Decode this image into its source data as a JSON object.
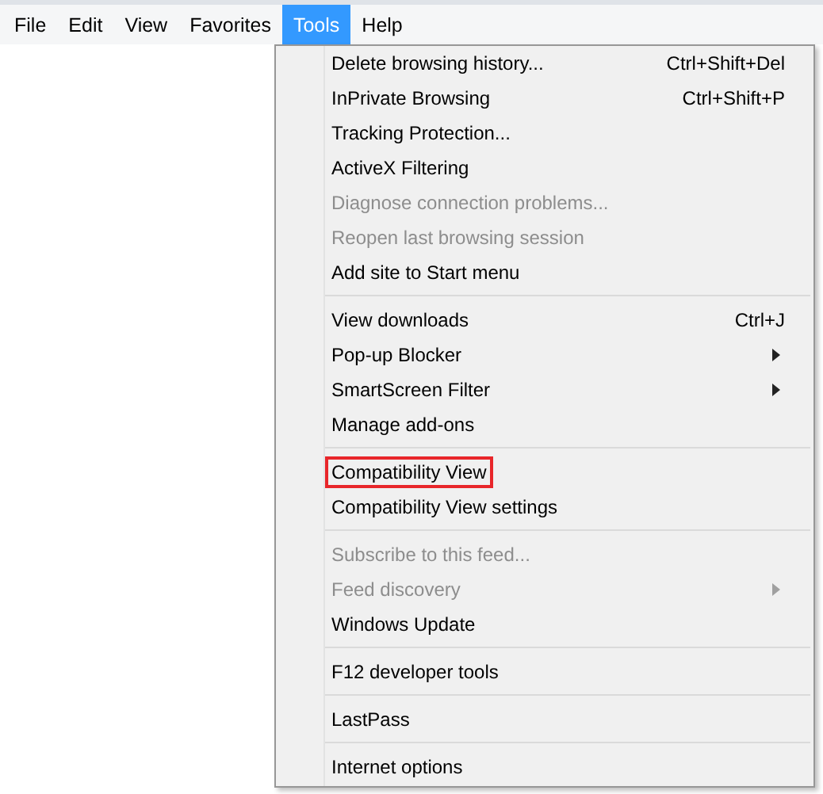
{
  "menubar": [
    {
      "label": "File",
      "selected": false
    },
    {
      "label": "Edit",
      "selected": false
    },
    {
      "label": "View",
      "selected": false
    },
    {
      "label": "Favorites",
      "selected": false
    },
    {
      "label": "Tools",
      "selected": true
    },
    {
      "label": "Help",
      "selected": false
    }
  ],
  "menu": [
    {
      "kind": "item",
      "label": "Delete browsing history...",
      "shortcut": "Ctrl+Shift+Del",
      "disabled": false,
      "submenu": false,
      "highlighted": false
    },
    {
      "kind": "item",
      "label": "InPrivate Browsing",
      "shortcut": "Ctrl+Shift+P",
      "disabled": false,
      "submenu": false,
      "highlighted": false
    },
    {
      "kind": "item",
      "label": "Tracking Protection...",
      "disabled": false,
      "submenu": false,
      "highlighted": false
    },
    {
      "kind": "item",
      "label": "ActiveX Filtering",
      "disabled": false,
      "submenu": false,
      "highlighted": false
    },
    {
      "kind": "item",
      "label": "Diagnose connection problems...",
      "disabled": true,
      "submenu": false,
      "highlighted": false
    },
    {
      "kind": "item",
      "label": "Reopen last browsing session",
      "disabled": true,
      "submenu": false,
      "highlighted": false
    },
    {
      "kind": "item",
      "label": "Add site to Start menu",
      "disabled": false,
      "submenu": false,
      "highlighted": false
    },
    {
      "kind": "separator"
    },
    {
      "kind": "item",
      "label": "View downloads",
      "shortcut": "Ctrl+J",
      "disabled": false,
      "submenu": false,
      "highlighted": false
    },
    {
      "kind": "item",
      "label": "Pop-up Blocker",
      "disabled": false,
      "submenu": true,
      "highlighted": false
    },
    {
      "kind": "item",
      "label": "SmartScreen Filter",
      "disabled": false,
      "submenu": true,
      "highlighted": false
    },
    {
      "kind": "item",
      "label": "Manage add-ons",
      "disabled": false,
      "submenu": false,
      "highlighted": false
    },
    {
      "kind": "separator"
    },
    {
      "kind": "item",
      "label": "Compatibility View",
      "disabled": false,
      "submenu": false,
      "highlighted": true
    },
    {
      "kind": "item",
      "label": "Compatibility View settings",
      "disabled": false,
      "submenu": false,
      "highlighted": false
    },
    {
      "kind": "separator"
    },
    {
      "kind": "item",
      "label": "Subscribe to this feed...",
      "disabled": true,
      "submenu": false,
      "highlighted": false
    },
    {
      "kind": "item",
      "label": "Feed discovery",
      "disabled": true,
      "submenu": true,
      "highlighted": false
    },
    {
      "kind": "item",
      "label": "Windows Update",
      "disabled": false,
      "submenu": false,
      "highlighted": false
    },
    {
      "kind": "separator"
    },
    {
      "kind": "item",
      "label": "F12 developer tools",
      "disabled": false,
      "submenu": false,
      "highlighted": false
    },
    {
      "kind": "separator"
    },
    {
      "kind": "item",
      "label": "LastPass",
      "disabled": false,
      "submenu": false,
      "highlighted": false
    },
    {
      "kind": "separator"
    },
    {
      "kind": "item",
      "label": "Internet options",
      "disabled": false,
      "submenu": false,
      "highlighted": false
    }
  ]
}
